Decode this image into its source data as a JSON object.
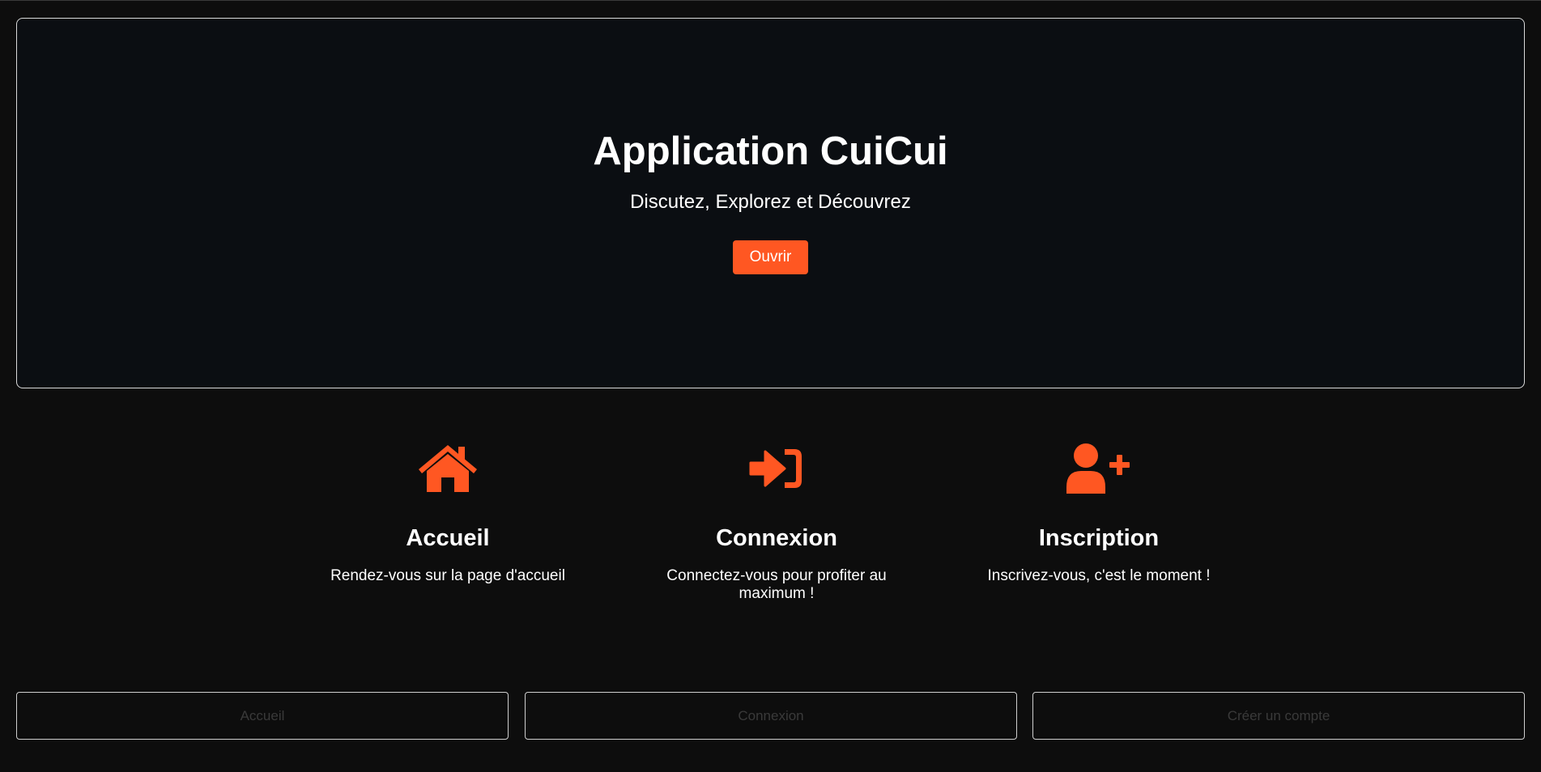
{
  "hero": {
    "title": "Application CuiCui",
    "subtitle": "Discutez, Explorez et Découvrez",
    "button_label": "Ouvrir"
  },
  "features": [
    {
      "icon": "home-icon",
      "title": "Accueil",
      "description": "Rendez-vous sur la page d'accueil"
    },
    {
      "icon": "sign-in-icon",
      "title": "Connexion",
      "description": "Connectez-vous pour profiter au maximum !"
    },
    {
      "icon": "user-plus-icon",
      "title": "Inscription",
      "description": "Inscrivez-vous, c'est le moment !"
    }
  ],
  "bottom_nav": [
    {
      "label": "Accueil"
    },
    {
      "label": "Connexion"
    },
    {
      "label": "Créer un compte"
    }
  ],
  "colors": {
    "accent": "#ff5722",
    "background": "#0d0d0d",
    "hero_background": "#0b0e12",
    "text": "#ffffff",
    "muted_button_text": "#3a3a3a"
  }
}
